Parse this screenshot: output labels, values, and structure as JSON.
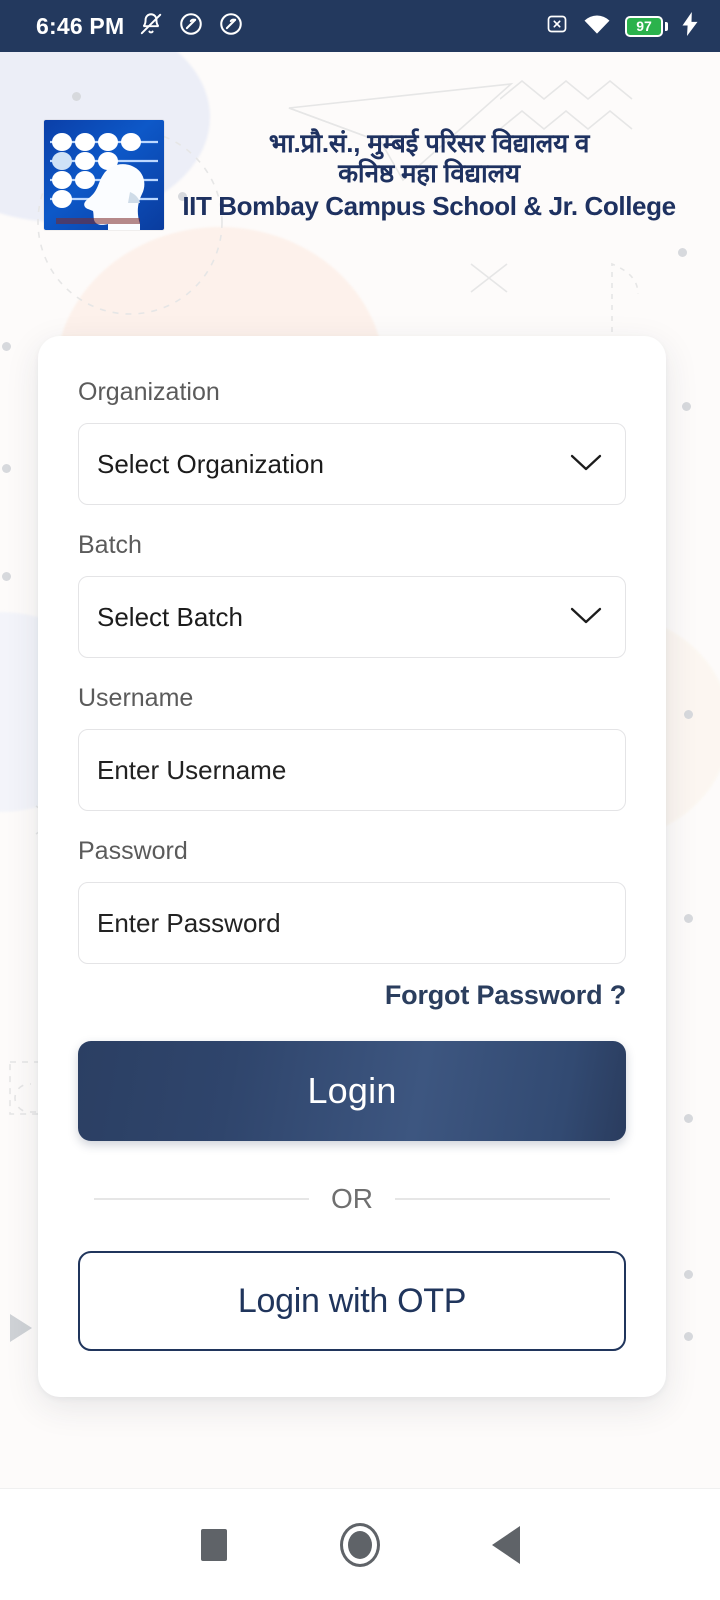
{
  "status_bar": {
    "time": "6:46 PM",
    "battery_percent": "97",
    "icons": [
      "bell-muted-icon",
      "dnd-circle-icon",
      "dnd-circle-icon",
      "sim-missing-icon",
      "wifi-icon",
      "battery-icon",
      "charging-bolt-icon"
    ],
    "bar_color": "#23395e",
    "battery_fill_color": "#2bb24c"
  },
  "header": {
    "logo_alt": "iit-bombay-campus-school-logo",
    "title_hi_line1": "भा.प्रौ.सं., मुम्बई परिसर विद्यालय व",
    "title_hi_line2": "कनिष्ठ महा विद्यालय",
    "title_en": "IIT Bombay Campus School & Jr. College",
    "title_color": "#1e3160"
  },
  "form": {
    "organization": {
      "label": "Organization",
      "value": "Select Organization",
      "icon": "chevron-down-icon"
    },
    "batch": {
      "label": "Batch",
      "value": "Select Batch",
      "icon": "chevron-down-icon"
    },
    "username": {
      "label": "Username",
      "placeholder": "Enter Username",
      "value": "Enter Username"
    },
    "password": {
      "label": "Password",
      "placeholder": "Enter Password",
      "value": "Enter Password"
    },
    "forgot_password": "Forgot Password ?",
    "login_button": "Login",
    "divider_label": "OR",
    "otp_button": "Login with OTP",
    "primary_color": "#2b3f63",
    "accent_color": "#20355c"
  },
  "nav_bar": {
    "recents": "recents-square-icon",
    "home": "home-circle-icon",
    "back": "back-triangle-icon"
  }
}
